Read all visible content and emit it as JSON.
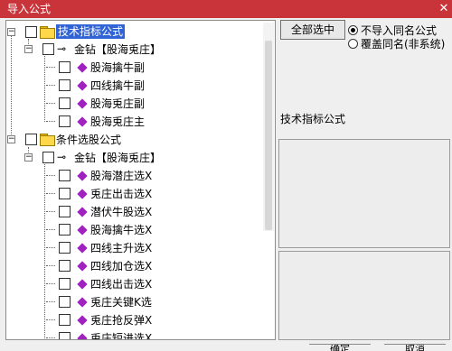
{
  "window": {
    "title": "导入公式",
    "close_glyph": "✕"
  },
  "tree": {
    "root_items": [
      {
        "label": "技术指标公式",
        "selected": true,
        "expanded": true
      },
      {
        "label": "条件选股公式",
        "selected": false,
        "expanded": true
      }
    ],
    "group1": {
      "label": "金钻【股海兎庄】"
    },
    "group1_items": [
      "股海擒牛副",
      "四线擒牛副",
      "股海兎庄副",
      "股海兎庄主"
    ],
    "group2": {
      "label": "金钻【股海兎庄】"
    },
    "group2_items": [
      "股海潜庄选X",
      "兎庄出击选X",
      "潜伏牛股选X",
      "股海擒牛选X",
      "四线主升选X",
      "四线加仓选X",
      "四线出击选X",
      "兎庄关键K选",
      "兎庄抢反弹X",
      "兎庄短进选X"
    ]
  },
  "options": {
    "select_all_label": "全部选中",
    "radio1_label": "不导入同名公式",
    "radio2_label": "覆盖同名(非系统)",
    "info_label": "技术指标公式"
  },
  "buttons": {
    "ok_label": "确定",
    "cancel_label": "取消"
  },
  "colors": {
    "titlebar": "#c9343b",
    "selection": "#2f63d6",
    "formula_icon": "#a020c0"
  }
}
